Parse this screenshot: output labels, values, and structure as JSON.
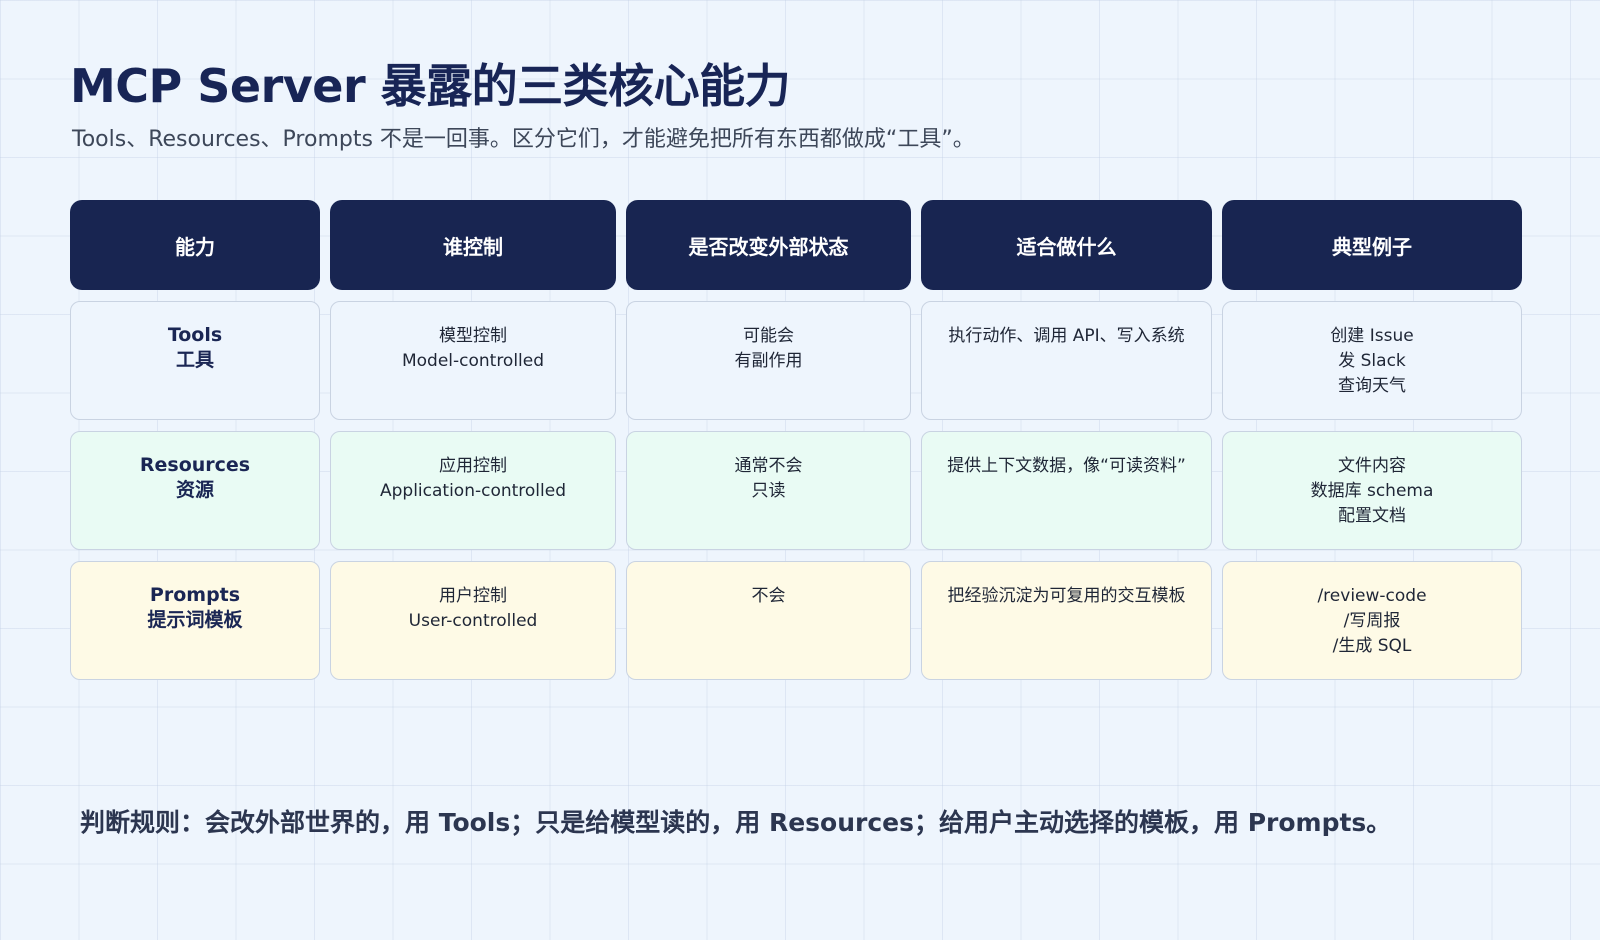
{
  "title": "MCP Server 暴露的三类核心能力",
  "subtitle": "Tools、Resources、Prompts 不是一回事。区分它们，才能避免把所有东西都做成“工具”。",
  "headers": [
    "能力",
    "谁控制",
    "是否改变外部状态",
    "适合做什么",
    "典型例子"
  ],
  "rows": [
    {
      "capability": [
        "Tools",
        "工具"
      ],
      "controller": [
        "模型控制",
        "Model-controlled"
      ],
      "changes_state": [
        "可能会",
        "有副作用"
      ],
      "use_for": [
        "执行动作、调用 API、写入系统"
      ],
      "examples": [
        "创建 Issue",
        "发 Slack",
        "查询天气"
      ]
    },
    {
      "capability": [
        "Resources",
        "资源"
      ],
      "controller": [
        "应用控制",
        "Application-controlled"
      ],
      "changes_state": [
        "通常不会",
        "只读"
      ],
      "use_for": [
        "提供上下文数据，像“可读资料”"
      ],
      "examples": [
        "文件内容",
        "数据库 schema",
        "配置文档"
      ]
    },
    {
      "capability": [
        "Prompts",
        "提示词模板"
      ],
      "controller": [
        "用户控制",
        "User-controlled"
      ],
      "changes_state": [
        "不会"
      ],
      "use_for": [
        "把经验沉淀为可复用的交互模板"
      ],
      "examples": [
        "/review-code",
        "/写周报",
        "/生成 SQL"
      ]
    }
  ],
  "rule": "判断规则：会改外部世界的，用 Tools；只是给模型读的，用 Resources；给用户主动选择的模板，用 Prompts。",
  "colors": {
    "background": "#eef5fd",
    "header": "#182551",
    "tools_row": "#eef5fd",
    "resources_row": "#e9fbf4",
    "prompts_row": "#fefae6",
    "title": "#182556"
  }
}
